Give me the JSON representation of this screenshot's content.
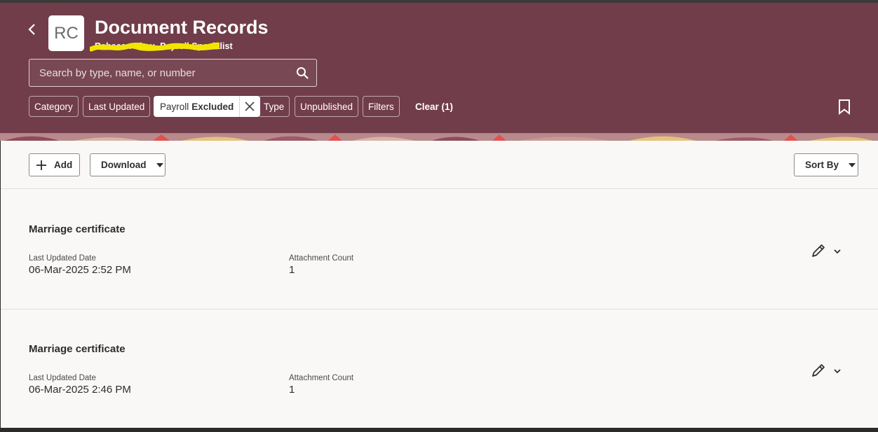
{
  "header": {
    "back_icon": "chevron-left-icon",
    "avatar_initials": "RC",
    "title": "Document Records",
    "subtitle": "Rebecca Chau, Payroll Specialist"
  },
  "search": {
    "placeholder": "Search by type, name, or number",
    "value": "",
    "icon": "search-icon"
  },
  "filters": {
    "chips": [
      {
        "label": "Category"
      },
      {
        "label": "Last Updated"
      },
      {
        "label": "Payroll",
        "value": "Excluded",
        "active": true
      },
      {
        "label": "Type"
      },
      {
        "label": "Unpublished"
      },
      {
        "label": "Filters"
      }
    ],
    "clear_label": "Clear (1)"
  },
  "toolbar": {
    "add_label": "Add",
    "download_label": "Download",
    "sort_label": "Sort By"
  },
  "records": [
    {
      "title": "Marriage certificate",
      "updated_label": "Last Updated Date",
      "updated_value": "06-Mar-2025 2:52 PM",
      "count_label": "Attachment Count",
      "count_value": "1"
    },
    {
      "title": "Marriage certificate",
      "updated_label": "Last Updated Date",
      "updated_value": "06-Mar-2025 2:46 PM",
      "count_label": "Attachment Count",
      "count_value": "1"
    }
  ],
  "colors": {
    "header_bg": "#713d4b",
    "content_bg": "#f9f8f6",
    "redaction": "#f2e600"
  }
}
